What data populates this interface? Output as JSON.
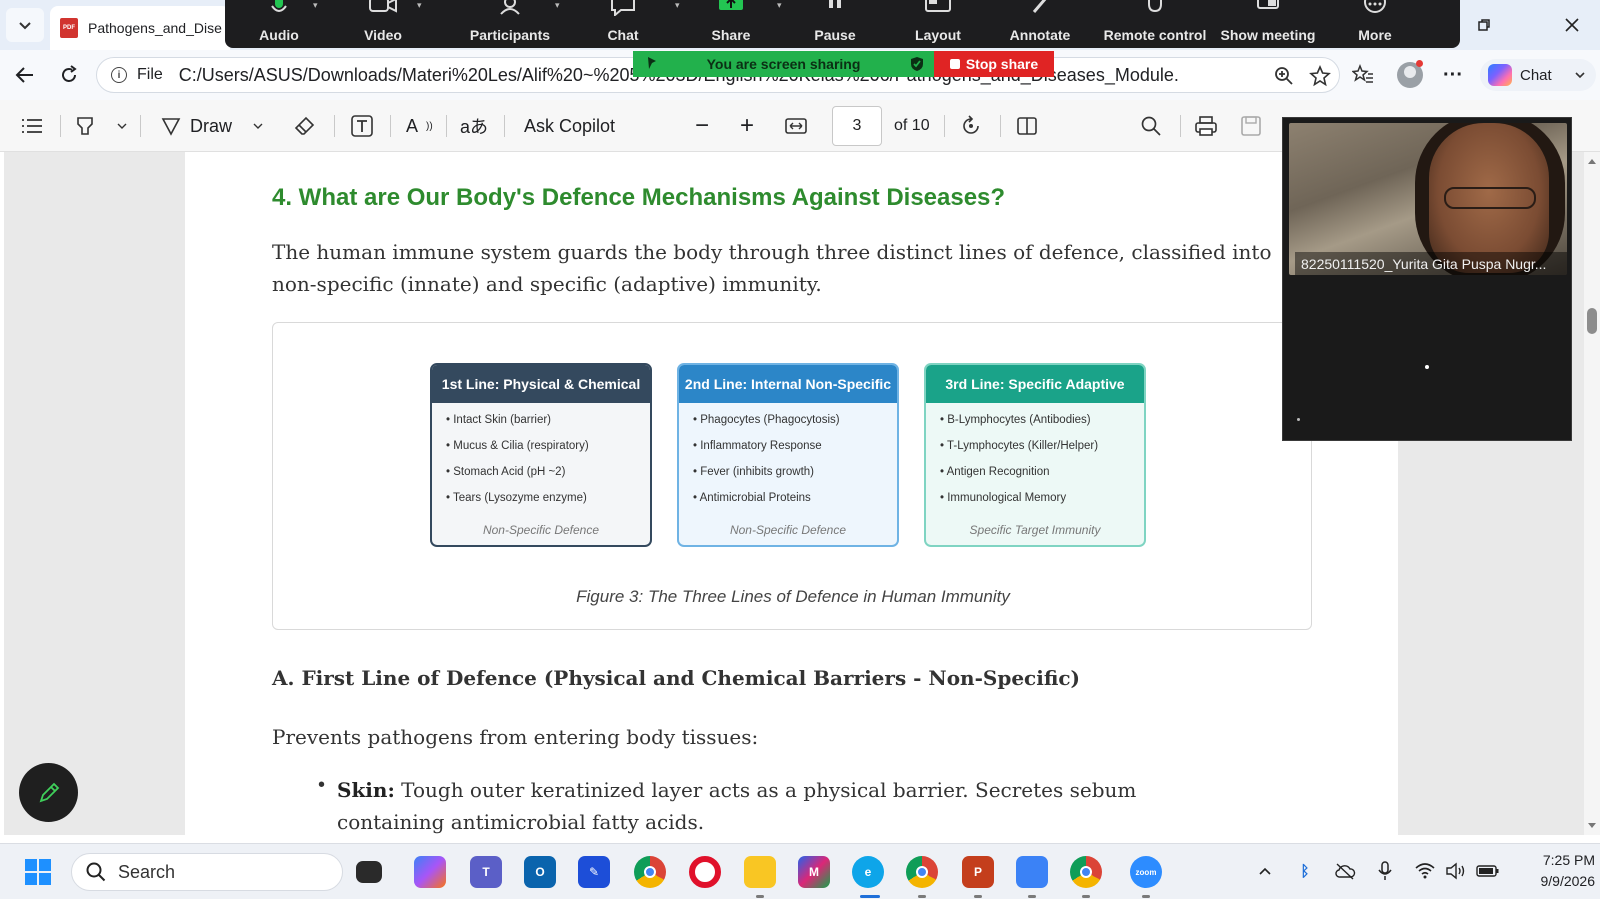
{
  "browser": {
    "tab_title": "Pathogens_and_Dise",
    "address": {
      "scheme_label": "File",
      "url": "C:/Users/ASUS/Downloads/Materi%20Les/Alif%20~%205%203D/English%20Kelas%206/Pathogens_and_Diseases_Module.pdf"
    },
    "chat_label": "Chat"
  },
  "zoom_toolbar": {
    "items": [
      "Audio",
      "Video",
      "Participants",
      "Chat",
      "Share",
      "Pause",
      "Layout",
      "Annotate",
      "Remote control",
      "Show meeting",
      "More"
    ],
    "sharing_banner": "You are screen sharing",
    "stop_share_label": "Stop share"
  },
  "pdf_toolbar": {
    "draw_label": "Draw",
    "ask_copilot_label": "Ask Copilot",
    "page_current": "3",
    "page_total_label": "of 10"
  },
  "document": {
    "section_heading": "4. What are Our Body's Defence Mechanisms Against Diseases?",
    "intro_paragraph": "The human immune system guards the body through three distinct lines of defence, classified into non-specific (innate) and specific (adaptive) immunity.",
    "figure": {
      "cards": [
        {
          "title": "1st Line: Physical & Chemical",
          "color": "#34495e",
          "items": [
            "Intact Skin (barrier)",
            "Mucus & Cilia (respiratory)",
            "Stomach Acid (pH ~2)",
            "Tears (Lysozyme enzyme)"
          ],
          "footer": "Non-Specific Defence"
        },
        {
          "title": "2nd Line: Internal Non-Specific",
          "color": "#2c86c8",
          "items": [
            "Phagocytes (Phagocytosis)",
            "Inflammatory Response",
            "Fever (inhibits growth)",
            "Antimicrobial Proteins"
          ],
          "footer": "Non-Specific Defence"
        },
        {
          "title": "3rd Line: Specific Adaptive",
          "color": "#1aa389",
          "items": [
            "B-Lymphocytes (Antibodies)",
            "T-Lymphocytes (Killer/Helper)",
            "Antigen Recognition",
            "Immunological Memory"
          ],
          "footer": "Specific Target Immunity"
        }
      ],
      "caption": "Figure 3: The Three Lines of Defence in Human Immunity"
    },
    "subheading": "A. First Line of Defence (Physical and Chemical Barriers - Non-Specific)",
    "lead_text": "Prevents pathogens from entering body tissues:",
    "bullet": {
      "term": "Skin:",
      "text": " Tough outer keratinized layer acts as a physical barrier. Secretes sebum containing antimicrobial fatty acids."
    }
  },
  "video_tile": {
    "participant_name": "82250111520_Yurita Gita Puspa Nugr..."
  },
  "taskbar": {
    "search_placeholder": "Search",
    "time": "7:25 PM",
    "date": "9/9/2026"
  }
}
